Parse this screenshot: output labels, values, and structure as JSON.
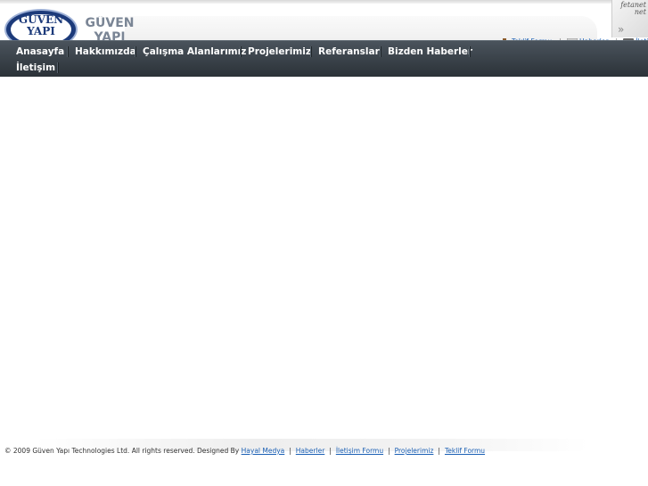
{
  "brand": {
    "logo_line1": "GÜVEN",
    "logo_line2": "YAPI",
    "side_text": "GÜVEN YAPI"
  },
  "quicklinks": [
    {
      "label": "Teklif Formu",
      "icon": "briefcase-icon"
    },
    {
      "label": "Haberler",
      "icon": "newspaper-icon"
    },
    {
      "label": "İletişim",
      "icon": "phone-icon"
    }
  ],
  "corner": {
    "line1": "fetanet",
    "line2": "net",
    "arrow": "»"
  },
  "nav": [
    {
      "label": "Anasayfa"
    },
    {
      "label": "Hakkımızda"
    },
    {
      "label": "Çalışma Alanlarımız"
    },
    {
      "label": "Projelerimiz"
    },
    {
      "label": "Referanslar"
    },
    {
      "label": "Bizden Haberler"
    },
    {
      "label": "İletişim"
    }
  ],
  "footer": {
    "copyright": "© 2009 Güven Yapı Technologies Ltd. All rights reserved. Designed By",
    "links": [
      "Hayal Medya",
      "Haberler",
      "İletişim Formu",
      "Projelerimiz",
      "Teklif Formu"
    ]
  },
  "colors": {
    "navbar": "#2b3238",
    "link": "#1a5fb4",
    "logo": "#1c3a7a"
  }
}
